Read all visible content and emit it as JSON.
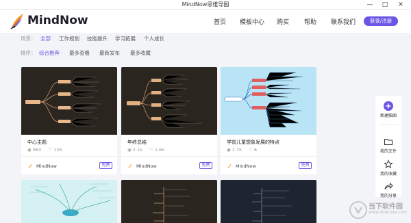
{
  "window": {
    "title": "MindNow思维导图",
    "minimize": "—",
    "maximize": "□",
    "close": "✕"
  },
  "header": {
    "logo_text": "MindNow",
    "nav": [
      "首页",
      "模板中心",
      "购买",
      "帮助",
      "联系我们"
    ],
    "login_label": "登录/注册"
  },
  "filters": {
    "scene_label": "场景：",
    "scenes": [
      "全部",
      "工作规划",
      "技能提升",
      "学习拓展",
      "个人成长"
    ],
    "sort_label": "排序：",
    "sorts": [
      "综合推荐",
      "最多查看",
      "最新发布",
      "最多收藏"
    ]
  },
  "cards": [
    {
      "title": "中心主题",
      "views": "963",
      "likes": "126",
      "author": "MindNow",
      "badge": "免费"
    },
    {
      "title": "年终总结",
      "views": "2.1k",
      "likes": "1.6k",
      "author": "MindNow",
      "badge": "免费"
    },
    {
      "title": "学前儿童想象发展的特点",
      "views": "1.7k",
      "likes": "6",
      "author": "MindNow",
      "badge": "免费"
    }
  ],
  "sidebar": {
    "new": "新建脑图",
    "files": "我的文件",
    "favorites": "我的收藏",
    "share": "我的分享"
  },
  "watermark": {
    "line1": "当下软件园",
    "line2": "www.downxia.com"
  },
  "colors": {
    "accent": "#6a56e6",
    "dark_thumb": "#2b2520",
    "light_thumb": "#b9e4f6"
  }
}
